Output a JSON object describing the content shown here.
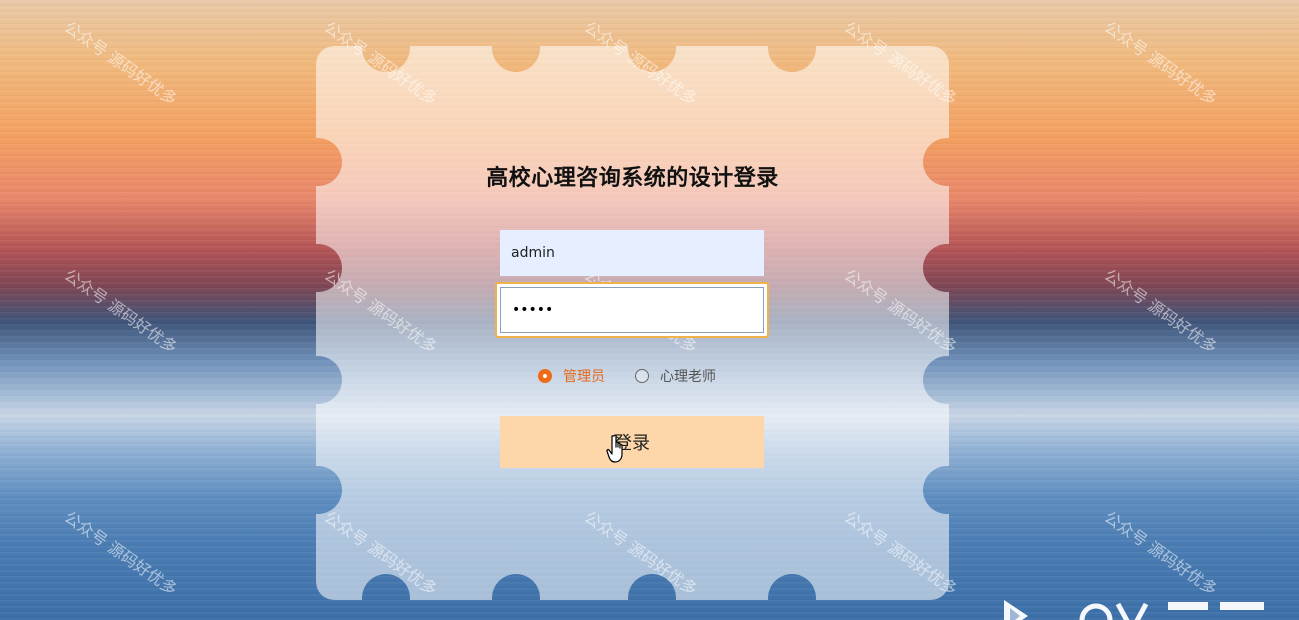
{
  "page": {
    "title": "高校心理咨询系统的设计登录"
  },
  "form": {
    "username_value": "admin",
    "password_value": "•••••",
    "login_label": "登录"
  },
  "roles": [
    {
      "label": "管理员",
      "checked": true
    },
    {
      "label": "心理老师",
      "checked": false
    }
  ],
  "watermark": {
    "text": "公众号 源码好优多"
  },
  "colors": {
    "accent": "#f06a17",
    "login_button": "#fdd7a9",
    "focus_border": "#f0b24a"
  },
  "icons": {
    "cursor": "hand-pointer-icon",
    "corner": "play-logo-icon"
  }
}
